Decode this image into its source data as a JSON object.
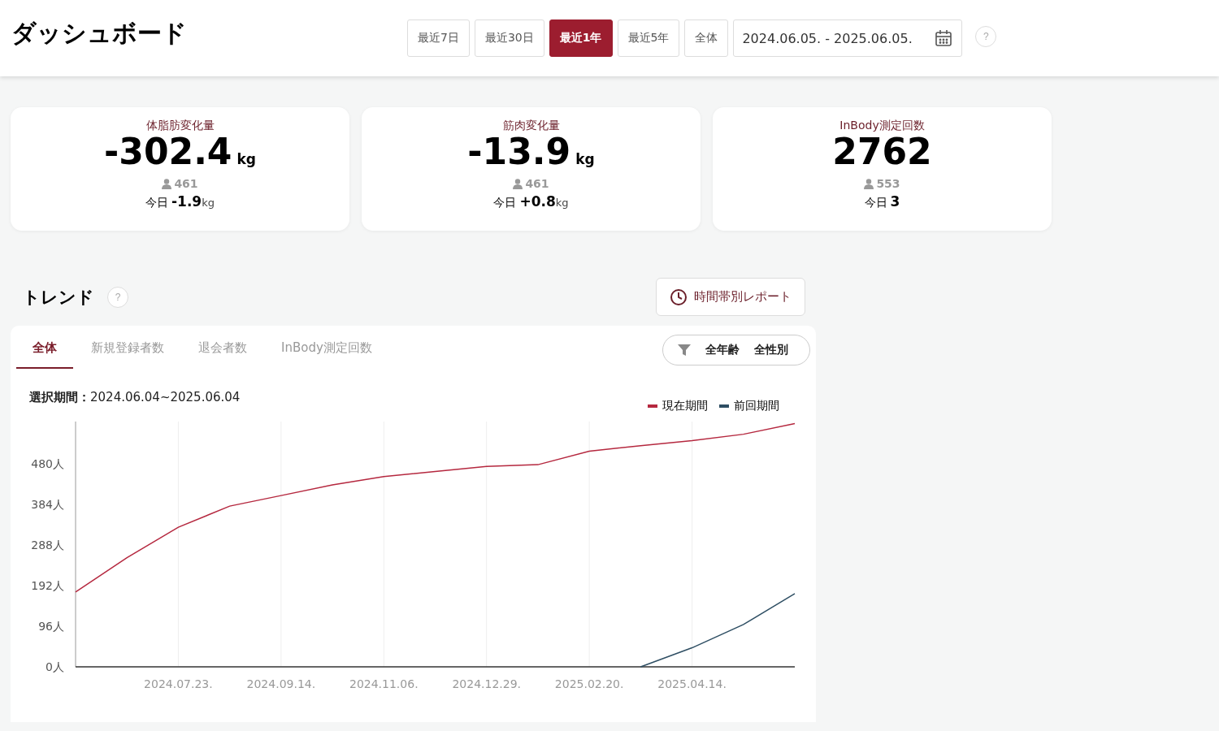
{
  "header": {
    "title": "ダッシュボード",
    "periods": [
      {
        "label": "最近7日",
        "selected": false
      },
      {
        "label": "最近30日",
        "selected": false
      },
      {
        "label": "最近1年",
        "selected": true
      },
      {
        "label": "最近5年",
        "selected": false
      },
      {
        "label": "全体",
        "selected": false
      }
    ],
    "date_range": "2024.06.05. - 2025.06.05.",
    "help": "?"
  },
  "stats": [
    {
      "title": "体脂肪変化量",
      "value": "-302.4",
      "unit": "kg",
      "members": "461",
      "today_label": "今日",
      "today_value": "-1.9",
      "today_unit": "kg"
    },
    {
      "title": "筋肉変化量",
      "value": "-13.9",
      "unit": "kg",
      "members": "461",
      "today_label": "今日",
      "today_value": "+0.8",
      "today_unit": "kg"
    },
    {
      "title": "InBody測定回数",
      "value": "2762",
      "members": "553",
      "today_label": "今日",
      "today_value": "3"
    }
  ],
  "trend": {
    "title": "トレンド",
    "help": "?",
    "report_button": "時間帯別レポート",
    "tabs": [
      {
        "label": "全体",
        "selected": true
      },
      {
        "label": "新規登録者数",
        "selected": false
      },
      {
        "label": "退会者数",
        "selected": false
      },
      {
        "label": "InBody測定回数",
        "selected": false
      }
    ],
    "filter": [
      "全年齢",
      "全性別"
    ],
    "period_label": "選択期間：",
    "period_value": "2024.06.04~2025.06.04",
    "chart_data": {
      "type": "line",
      "categories": [
        null,
        null,
        "2024.07.23.",
        null,
        "2024.09.14.",
        null,
        "2024.11.06.",
        null,
        "2024.12.29.",
        null,
        "2025.02.20.",
        null,
        "2025.04.14.",
        null,
        null
      ],
      "ylim": [
        0,
        580
      ],
      "grid": true,
      "yticks": [
        {
          "value": 0,
          "label": "0人"
        },
        {
          "value": 96,
          "label": "96人"
        },
        {
          "value": 192,
          "label": "192人"
        },
        {
          "value": 288,
          "label": "288人"
        },
        {
          "value": 384,
          "label": "384人"
        },
        {
          "value": 480,
          "label": "480人"
        }
      ],
      "series": [
        {
          "name": "現在期間",
          "color": "#b5283f",
          "values": [
            177,
            258,
            330,
            380,
            405,
            430,
            450,
            462,
            474,
            478,
            510,
            523,
            535,
            550,
            575
          ]
        },
        {
          "name": "前回期間",
          "color": "#2e4e63",
          "values": [
            null,
            null,
            null,
            null,
            null,
            null,
            null,
            null,
            null,
            null,
            null,
            0,
            45,
            100,
            173
          ]
        }
      ]
    }
  }
}
